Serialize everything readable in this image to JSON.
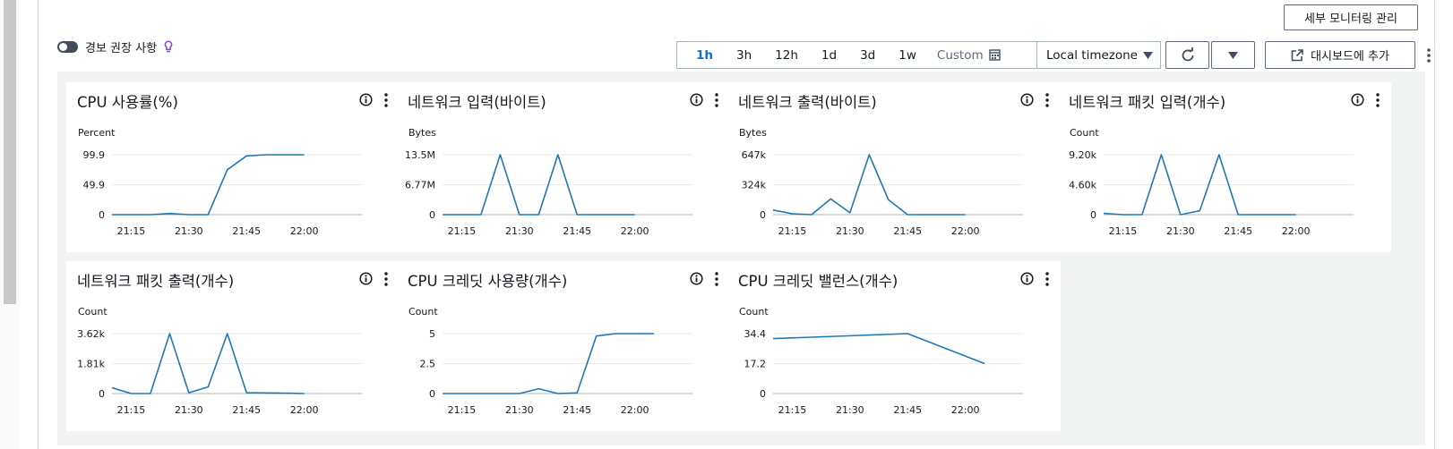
{
  "header": {
    "manage_button": "세부 모니터링 관리",
    "alarm_toggle_label": "경보 권장 사항"
  },
  "toolbar": {
    "ranges": [
      "1h",
      "3h",
      "12h",
      "1d",
      "3d",
      "1w"
    ],
    "active_range": "1h",
    "custom_label": "Custom",
    "timezone": "Local timezone",
    "add_to_dashboard": "대시보드에 추가"
  },
  "colors": {
    "line": "#1f77b4",
    "accent": "#0972d3",
    "bulb": "#8a43d6"
  },
  "charts": [
    {
      "title": "CPU 사용률(%)",
      "chart_data": {
        "type": "line",
        "unit": "Percent",
        "yticks": [
          "99.9",
          "49.9",
          "0"
        ],
        "ylim": [
          0,
          99.9
        ],
        "xticks": [
          "21:15",
          "21:30",
          "21:45",
          "22:00"
        ],
        "x": [
          "21:10",
          "21:15",
          "21:20",
          "21:25",
          "21:30",
          "21:35",
          "21:40",
          "21:45",
          "21:50",
          "21:55",
          "22:00"
        ],
        "values": [
          0,
          0,
          0,
          2,
          0,
          0,
          75,
          98,
          99.9,
          99.9,
          99.9
        ]
      }
    },
    {
      "title": "네트워크 입력(바이트)",
      "chart_data": {
        "type": "line",
        "unit": "Bytes",
        "yticks": [
          "13.5M",
          "6.77M",
          "0"
        ],
        "ylim": [
          0,
          13.5
        ],
        "xticks": [
          "21:15",
          "21:30",
          "21:45",
          "22:00"
        ],
        "x": [
          "21:10",
          "21:15",
          "21:20",
          "21:25",
          "21:30",
          "21:35",
          "21:40",
          "21:45",
          "21:50",
          "21:55",
          "22:00"
        ],
        "values": [
          0,
          0,
          0,
          13.5,
          0,
          0,
          13.5,
          0,
          0,
          0,
          0
        ]
      }
    },
    {
      "title": "네트워크 출력(바이트)",
      "chart_data": {
        "type": "line",
        "unit": "Bytes",
        "yticks": [
          "647k",
          "324k",
          "0"
        ],
        "ylim": [
          0,
          647
        ],
        "xticks": [
          "21:15",
          "21:30",
          "21:45",
          "22:00"
        ],
        "x": [
          "21:10",
          "21:15",
          "21:20",
          "21:25",
          "21:30",
          "21:35",
          "21:40",
          "21:45",
          "21:50",
          "21:55",
          "22:00"
        ],
        "values": [
          50,
          10,
          0,
          170,
          20,
          647,
          160,
          0,
          0,
          0,
          0
        ]
      }
    },
    {
      "title": "네트워크 패킷 입력(개수)",
      "chart_data": {
        "type": "line",
        "unit": "Count",
        "yticks": [
          "9.20k",
          "4.60k",
          "0"
        ],
        "ylim": [
          0,
          9.2
        ],
        "xticks": [
          "21:15",
          "21:30",
          "21:45",
          "22:00"
        ],
        "x": [
          "21:10",
          "21:15",
          "21:20",
          "21:25",
          "21:30",
          "21:35",
          "21:40",
          "21:45",
          "21:50",
          "21:55",
          "22:00"
        ],
        "values": [
          0.2,
          0,
          0,
          9.2,
          0,
          0.6,
          9.2,
          0,
          0,
          0,
          0
        ]
      }
    },
    {
      "title": "네트워크 패킷 출력(개수)",
      "chart_data": {
        "type": "line",
        "unit": "Count",
        "yticks": [
          "3.62k",
          "1.81k",
          "0"
        ],
        "ylim": [
          0,
          3.62
        ],
        "xticks": [
          "21:15",
          "21:30",
          "21:45",
          "22:00"
        ],
        "x": [
          "21:10",
          "21:15",
          "21:20",
          "21:25",
          "21:30",
          "21:35",
          "21:40",
          "21:45",
          "21:50",
          "21:55",
          "22:00"
        ],
        "values": [
          0.35,
          0,
          0,
          3.62,
          0.05,
          0.4,
          3.62,
          0.05,
          0.04,
          0.02,
          0
        ]
      }
    },
    {
      "title": "CPU 크레딧 사용량(개수)",
      "chart_data": {
        "type": "line",
        "unit": "Count",
        "yticks": [
          "5",
          "2.5",
          "0"
        ],
        "ylim": [
          0,
          5
        ],
        "xticks": [
          "21:15",
          "21:30",
          "21:45",
          "22:00"
        ],
        "x": [
          "21:10",
          "21:15",
          "21:20",
          "21:25",
          "21:30",
          "21:35",
          "21:40",
          "21:45",
          "21:50",
          "21:55",
          "22:00",
          "22:05"
        ],
        "values": [
          0,
          0,
          0,
          0,
          0,
          0.4,
          0,
          0.05,
          4.8,
          5,
          5,
          5
        ]
      }
    },
    {
      "title": "CPU 크레딧 밸런스(개수)",
      "chart_data": {
        "type": "line",
        "unit": "Count",
        "yticks": [
          "34.4",
          "17.2",
          "0"
        ],
        "ylim": [
          0,
          34.4
        ],
        "xticks": [
          "21:15",
          "21:30",
          "21:45",
          "22:00"
        ],
        "x": [
          "21:10",
          "21:45",
          "22:05"
        ],
        "values": [
          31.5,
          34.4,
          17.2
        ]
      }
    }
  ]
}
